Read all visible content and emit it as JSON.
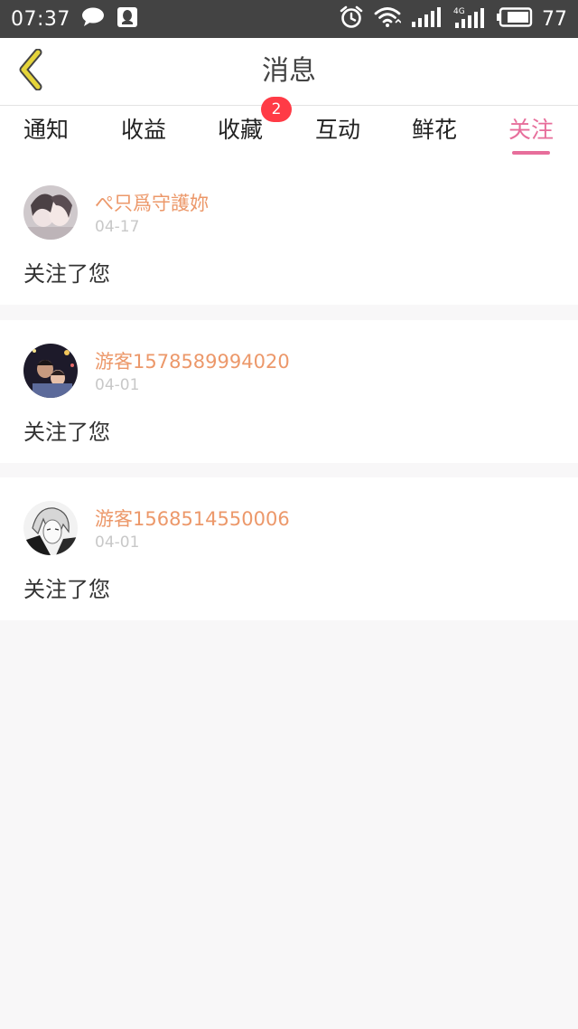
{
  "status_bar": {
    "time": "07:37",
    "battery": "77",
    "icons": [
      "chat-bubble-icon",
      "qq-icon",
      "alarm-icon",
      "wifi-icon",
      "signal-icon",
      "signal-4g-icon",
      "battery-icon"
    ]
  },
  "header": {
    "title": "消息",
    "back_icon": "chevron-left-icon"
  },
  "tabs": [
    {
      "label": "通知"
    },
    {
      "label": "收益"
    },
    {
      "label": "收藏",
      "badge": "2"
    },
    {
      "label": "互动"
    },
    {
      "label": "鲜花"
    },
    {
      "label": "关注",
      "active": true
    }
  ],
  "notifications": [
    {
      "username": "ぺ只爲守護妳",
      "date": "04-17",
      "message": "关注了您"
    },
    {
      "username": "游客1578589994020",
      "date": "04-01",
      "message": "关注了您"
    },
    {
      "username": "游客1568514550006",
      "date": "04-01",
      "message": "关注了您"
    }
  ],
  "colors": {
    "status_bar": "#434343",
    "accent": "#e76e9b",
    "username": "#ec986a",
    "badge": "#ff3b46",
    "page_background": "#f8f7f8",
    "back_icon": "#d4c12a"
  }
}
